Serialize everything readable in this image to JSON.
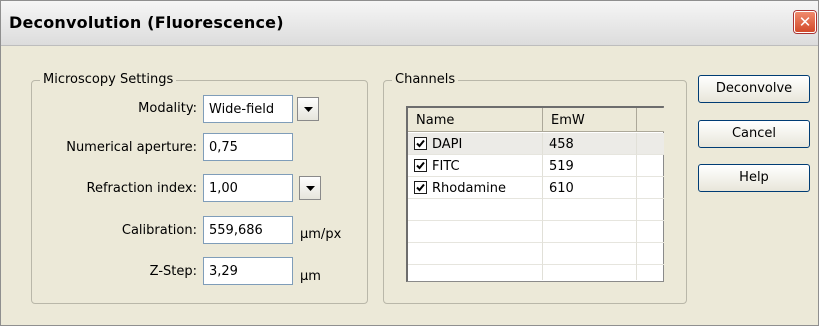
{
  "window": {
    "title": "Deconvolution (Fluorescence)",
    "close_symbol": "✕"
  },
  "microscopy": {
    "legend": "Microscopy Settings",
    "modality_label": "Modality:",
    "modality_value": "Wide-field",
    "na_label": "Numerical aperture:",
    "na_value": "0,75",
    "ri_label": "Refraction index:",
    "ri_value": "1,00",
    "calibration_label": "Calibration:",
    "calibration_value": "559,686",
    "calibration_unit": "µm/px",
    "zstep_label": "Z-Step:",
    "zstep_value": "3,29",
    "zstep_unit": "µm"
  },
  "channels": {
    "legend": "Channels",
    "headers": {
      "name": "Name",
      "emw": "EmW"
    },
    "rows": [
      {
        "name": "DAPI",
        "emw": "458",
        "checked": true
      },
      {
        "name": "FITC",
        "emw": "519",
        "checked": true
      },
      {
        "name": "Rhodamine",
        "emw": "610",
        "checked": true
      }
    ]
  },
  "buttons": {
    "deconvolve": "Deconvolve",
    "cancel": "Cancel",
    "help": "Help"
  },
  "icons": {
    "close": "close-icon",
    "dropdown": "chevron-down-icon",
    "check": "checkmark-icon"
  }
}
